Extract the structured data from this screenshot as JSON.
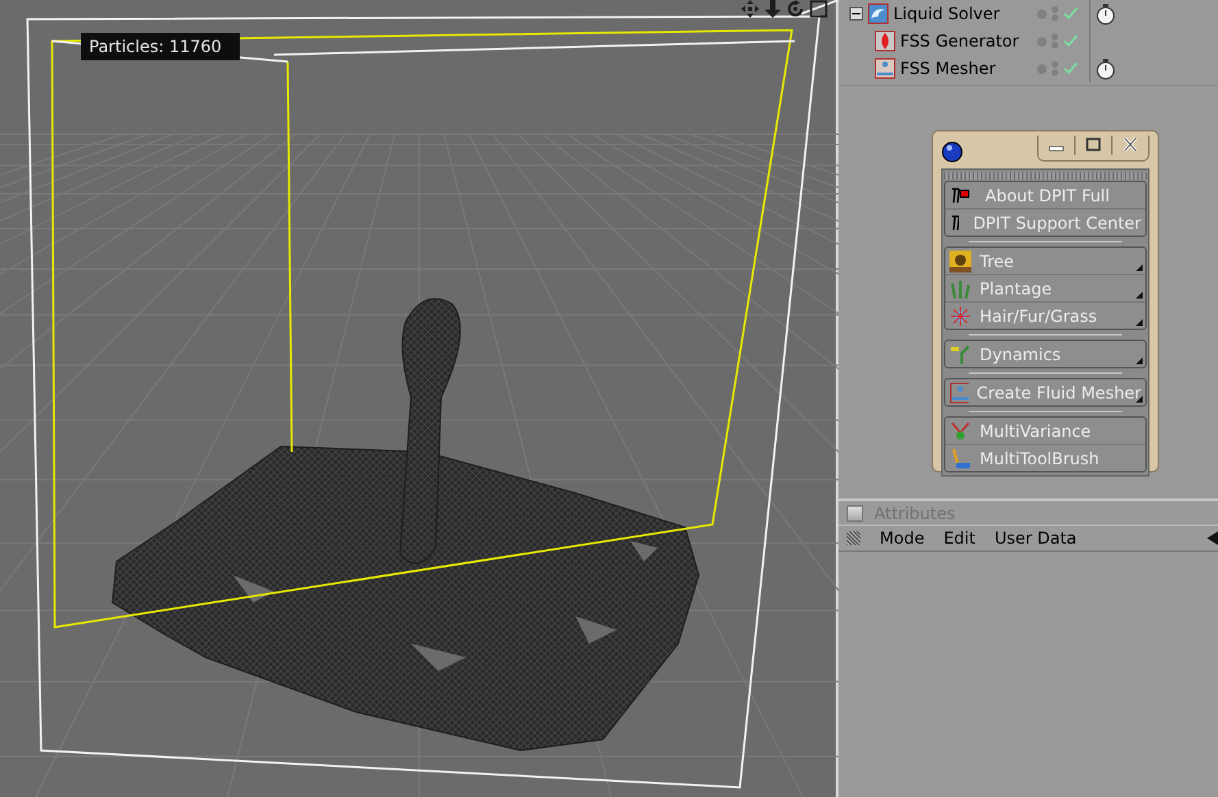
{
  "viewport": {
    "overlay": "Particles: 11760"
  },
  "objects": [
    {
      "name": "Liquid Solver",
      "kind": "solver",
      "expanded": true,
      "timer": true,
      "children": [
        {
          "name": "FSS Generator",
          "kind": "generator",
          "timer": false
        },
        {
          "name": "FSS Mesher",
          "kind": "mesher",
          "timer": true
        }
      ]
    }
  ],
  "palette": {
    "groups": [
      [
        {
          "label": "About DPIT Full",
          "kind": "info",
          "submenu": false
        },
        {
          "label": "DPIT Support Center",
          "kind": "info",
          "submenu": false
        }
      ],
      [
        {
          "label": "Tree",
          "kind": "tree",
          "submenu": true
        },
        {
          "label": "Plantage",
          "kind": "plant",
          "submenu": true
        },
        {
          "label": "Hair/Fur/Grass",
          "kind": "hair",
          "submenu": true
        }
      ],
      [
        {
          "label": "Dynamics",
          "kind": "dynamics",
          "submenu": true
        }
      ],
      [
        {
          "label": "Create Fluid Mesher",
          "kind": "mesher",
          "submenu": true
        }
      ],
      [
        {
          "label": "MultiVariance",
          "kind": "variance",
          "submenu": false
        },
        {
          "label": "MultiToolBrush",
          "kind": "brush",
          "submenu": false
        }
      ]
    ]
  },
  "attributes": {
    "title": "Attributes",
    "checked": false,
    "menu": [
      "Mode",
      "Edit",
      "User Data"
    ]
  }
}
